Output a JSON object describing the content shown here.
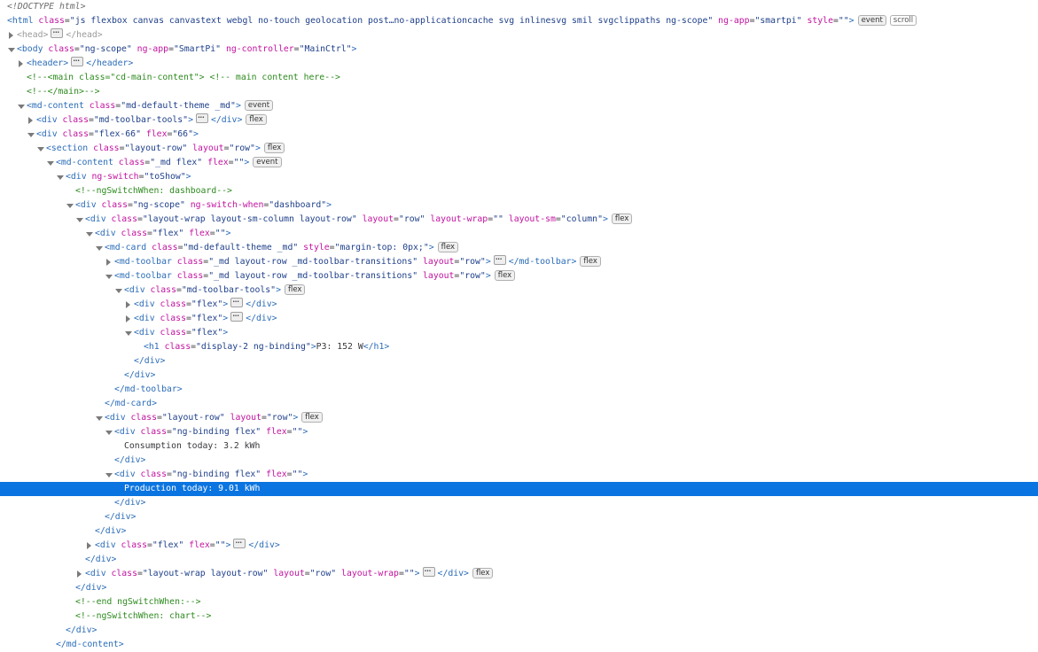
{
  "colors": {
    "selection": "#0a74e0",
    "tag": "#2b6cb8",
    "attr": "#c2129f",
    "value": "#1e3f8a",
    "comment": "#2e8a1f"
  },
  "rows": [
    {
      "depth": -1,
      "twisty": "none",
      "parts": [
        [
          "doctype",
          "<!DOCTYPE html>"
        ]
      ]
    },
    {
      "depth": -1,
      "twisty": "none",
      "parts": [
        [
          "tag",
          "<html"
        ],
        [
          "attr",
          " class"
        ],
        [
          "eq",
          "="
        ],
        [
          "val",
          "\"js flexbox canvas canvastext webgl no-touch geolocation post…no-applicationcache svg inlinesvg smil svgclippaths ng-scope\""
        ],
        [
          "attr",
          " ng-app"
        ],
        [
          "eq",
          "="
        ],
        [
          "val",
          "\"smartpi\""
        ],
        [
          "attr",
          " style"
        ],
        [
          "eq",
          "="
        ],
        [
          "val",
          "\"\""
        ],
        [
          "tag",
          ">"
        ],
        [
          "badge",
          "event"
        ],
        [
          "badge-scroll",
          "scroll"
        ]
      ]
    },
    {
      "depth": 0,
      "twisty": "closed",
      "dim": true,
      "parts": [
        [
          "tag",
          "<head>"
        ],
        [
          "ell",
          "…"
        ],
        [
          "tag",
          "</head>"
        ]
      ]
    },
    {
      "depth": 0,
      "twisty": "open",
      "parts": [
        [
          "tag",
          "<body"
        ],
        [
          "attr",
          " class"
        ],
        [
          "eq",
          "="
        ],
        [
          "val",
          "\"ng-scope\""
        ],
        [
          "attr",
          " ng-app"
        ],
        [
          "eq",
          "="
        ],
        [
          "val",
          "\"SmartPi\""
        ],
        [
          "attr",
          " ng-controller"
        ],
        [
          "eq",
          "="
        ],
        [
          "val",
          "\"MainCtrl\""
        ],
        [
          "tag",
          ">"
        ]
      ]
    },
    {
      "depth": 1,
      "twisty": "closed",
      "parts": [
        [
          "tag",
          "<header>"
        ],
        [
          "ell",
          "…"
        ],
        [
          "tag",
          "</header>"
        ]
      ]
    },
    {
      "depth": 1,
      "twisty": "none",
      "parts": [
        [
          "comment",
          "<!--<main class=\"cd-main-content\"> <!-- main content here-->"
        ]
      ]
    },
    {
      "depth": 1,
      "twisty": "none",
      "parts": [
        [
          "comment",
          "<!--</main>-->"
        ]
      ]
    },
    {
      "depth": 1,
      "twisty": "open",
      "parts": [
        [
          "tag",
          "<md-content"
        ],
        [
          "attr",
          " class"
        ],
        [
          "eq",
          "="
        ],
        [
          "val",
          "\"md-default-theme _md\""
        ],
        [
          "tag",
          ">"
        ],
        [
          "badge",
          "event"
        ]
      ]
    },
    {
      "depth": 2,
      "twisty": "closed",
      "parts": [
        [
          "tag",
          "<div"
        ],
        [
          "attr",
          " class"
        ],
        [
          "eq",
          "="
        ],
        [
          "val",
          "\"md-toolbar-tools\""
        ],
        [
          "tag",
          ">"
        ],
        [
          "ell",
          "…"
        ],
        [
          "tag",
          "</div>"
        ],
        [
          "badge",
          "flex"
        ]
      ]
    },
    {
      "depth": 2,
      "twisty": "open",
      "parts": [
        [
          "tag",
          "<div"
        ],
        [
          "attr",
          " class"
        ],
        [
          "eq",
          "="
        ],
        [
          "val",
          "\"flex-66\""
        ],
        [
          "attr",
          " flex"
        ],
        [
          "eq",
          "="
        ],
        [
          "val",
          "\"66\""
        ],
        [
          "tag",
          ">"
        ]
      ]
    },
    {
      "depth": 3,
      "twisty": "open",
      "parts": [
        [
          "tag",
          "<section"
        ],
        [
          "attr",
          " class"
        ],
        [
          "eq",
          "="
        ],
        [
          "val",
          "\"layout-row\""
        ],
        [
          "attr",
          " layout"
        ],
        [
          "eq",
          "="
        ],
        [
          "val",
          "\"row\""
        ],
        [
          "tag",
          ">"
        ],
        [
          "badge",
          "flex"
        ]
      ]
    },
    {
      "depth": 4,
      "twisty": "open",
      "parts": [
        [
          "tag",
          "<md-content"
        ],
        [
          "attr",
          " class"
        ],
        [
          "eq",
          "="
        ],
        [
          "val",
          "\"_md flex\""
        ],
        [
          "attr",
          " flex"
        ],
        [
          "eq",
          "="
        ],
        [
          "val",
          "\"\""
        ],
        [
          "tag",
          ">"
        ],
        [
          "badge",
          "event"
        ]
      ]
    },
    {
      "depth": 5,
      "twisty": "open",
      "parts": [
        [
          "tag",
          "<div"
        ],
        [
          "attr",
          " ng-switch"
        ],
        [
          "eq",
          "="
        ],
        [
          "val",
          "\"toShow\""
        ],
        [
          "tag",
          ">"
        ]
      ]
    },
    {
      "depth": 6,
      "twisty": "none",
      "parts": [
        [
          "comment",
          "<!--ngSwitchWhen: dashboard-->"
        ]
      ]
    },
    {
      "depth": 6,
      "twisty": "open",
      "parts": [
        [
          "tag",
          "<div"
        ],
        [
          "attr",
          " class"
        ],
        [
          "eq",
          "="
        ],
        [
          "val",
          "\"ng-scope\""
        ],
        [
          "attr",
          " ng-switch-when"
        ],
        [
          "eq",
          "="
        ],
        [
          "val",
          "\"dashboard\""
        ],
        [
          "tag",
          ">"
        ]
      ]
    },
    {
      "depth": 7,
      "twisty": "open",
      "parts": [
        [
          "tag",
          "<div"
        ],
        [
          "attr",
          " class"
        ],
        [
          "eq",
          "="
        ],
        [
          "val",
          "\"layout-wrap layout-sm-column layout-row\""
        ],
        [
          "attr",
          " layout"
        ],
        [
          "eq",
          "="
        ],
        [
          "val",
          "\"row\""
        ],
        [
          "attr",
          " layout-wrap"
        ],
        [
          "eq",
          "="
        ],
        [
          "val",
          "\"\""
        ],
        [
          "attr",
          " layout-sm"
        ],
        [
          "eq",
          "="
        ],
        [
          "val",
          "\"column\""
        ],
        [
          "tag",
          ">"
        ],
        [
          "badge",
          "flex"
        ]
      ]
    },
    {
      "depth": 8,
      "twisty": "open",
      "parts": [
        [
          "tag",
          "<div"
        ],
        [
          "attr",
          " class"
        ],
        [
          "eq",
          "="
        ],
        [
          "val",
          "\"flex\""
        ],
        [
          "attr",
          " flex"
        ],
        [
          "eq",
          "="
        ],
        [
          "val",
          "\"\""
        ],
        [
          "tag",
          ">"
        ]
      ]
    },
    {
      "depth": 9,
      "twisty": "open",
      "parts": [
        [
          "tag",
          "<md-card"
        ],
        [
          "attr",
          " class"
        ],
        [
          "eq",
          "="
        ],
        [
          "val",
          "\"md-default-theme _md\""
        ],
        [
          "attr",
          " style"
        ],
        [
          "eq",
          "="
        ],
        [
          "val",
          "\"margin-top: 0px;\""
        ],
        [
          "tag",
          ">"
        ],
        [
          "badge",
          "flex"
        ]
      ]
    },
    {
      "depth": 10,
      "twisty": "closed",
      "parts": [
        [
          "tag",
          "<md-toolbar"
        ],
        [
          "attr",
          " class"
        ],
        [
          "eq",
          "="
        ],
        [
          "val",
          "\"_md layout-row _md-toolbar-transitions\""
        ],
        [
          "attr",
          " layout"
        ],
        [
          "eq",
          "="
        ],
        [
          "val",
          "\"row\""
        ],
        [
          "tag",
          ">"
        ],
        [
          "ell",
          "…"
        ],
        [
          "tag",
          "</md-toolbar>"
        ],
        [
          "badge",
          "flex"
        ]
      ]
    },
    {
      "depth": 10,
      "twisty": "open",
      "parts": [
        [
          "tag",
          "<md-toolbar"
        ],
        [
          "attr",
          " class"
        ],
        [
          "eq",
          "="
        ],
        [
          "val",
          "\"_md layout-row _md-toolbar-transitions\""
        ],
        [
          "attr",
          " layout"
        ],
        [
          "eq",
          "="
        ],
        [
          "val",
          "\"row\""
        ],
        [
          "tag",
          ">"
        ],
        [
          "badge",
          "flex"
        ]
      ]
    },
    {
      "depth": 11,
      "twisty": "open",
      "parts": [
        [
          "tag",
          "<div"
        ],
        [
          "attr",
          " class"
        ],
        [
          "eq",
          "="
        ],
        [
          "val",
          "\"md-toolbar-tools\""
        ],
        [
          "tag",
          ">"
        ],
        [
          "badge",
          "flex"
        ]
      ]
    },
    {
      "depth": 12,
      "twisty": "closed",
      "parts": [
        [
          "tag",
          "<div"
        ],
        [
          "attr",
          " class"
        ],
        [
          "eq",
          "="
        ],
        [
          "val",
          "\"flex\""
        ],
        [
          "tag",
          ">"
        ],
        [
          "ell",
          "…"
        ],
        [
          "tag",
          "</div>"
        ]
      ]
    },
    {
      "depth": 12,
      "twisty": "closed",
      "parts": [
        [
          "tag",
          "<div"
        ],
        [
          "attr",
          " class"
        ],
        [
          "eq",
          "="
        ],
        [
          "val",
          "\"flex\""
        ],
        [
          "tag",
          ">"
        ],
        [
          "ell",
          "…"
        ],
        [
          "tag",
          "</div>"
        ]
      ]
    },
    {
      "depth": 12,
      "twisty": "open",
      "parts": [
        [
          "tag",
          "<div"
        ],
        [
          "attr",
          " class"
        ],
        [
          "eq",
          "="
        ],
        [
          "val",
          "\"flex\""
        ],
        [
          "tag",
          ">"
        ]
      ]
    },
    {
      "depth": 13,
      "twisty": "none",
      "parts": [
        [
          "tag",
          "<h1"
        ],
        [
          "attr",
          " class"
        ],
        [
          "eq",
          "="
        ],
        [
          "val",
          "\"display-2 ng-binding\""
        ],
        [
          "tag",
          ">"
        ],
        [
          "text",
          "P3: 152 W"
        ],
        [
          "tag",
          "</h1>"
        ]
      ]
    },
    {
      "depth": 12,
      "twisty": "none",
      "parts": [
        [
          "tag",
          "</div>"
        ]
      ]
    },
    {
      "depth": 11,
      "twisty": "none",
      "parts": [
        [
          "tag",
          "</div>"
        ]
      ]
    },
    {
      "depth": 10,
      "twisty": "none",
      "parts": [
        [
          "tag",
          "</md-toolbar>"
        ]
      ]
    },
    {
      "depth": 9,
      "twisty": "none",
      "parts": [
        [
          "tag",
          "</md-card>"
        ]
      ]
    },
    {
      "depth": 9,
      "twisty": "open",
      "parts": [
        [
          "tag",
          "<div"
        ],
        [
          "attr",
          " class"
        ],
        [
          "eq",
          "="
        ],
        [
          "val",
          "\"layout-row\""
        ],
        [
          "attr",
          " layout"
        ],
        [
          "eq",
          "="
        ],
        [
          "val",
          "\"row\""
        ],
        [
          "tag",
          ">"
        ],
        [
          "badge",
          "flex"
        ]
      ]
    },
    {
      "depth": 10,
      "twisty": "open",
      "parts": [
        [
          "tag",
          "<div"
        ],
        [
          "attr",
          " class"
        ],
        [
          "eq",
          "="
        ],
        [
          "val",
          "\"ng-binding flex\""
        ],
        [
          "attr",
          " flex"
        ],
        [
          "eq",
          "="
        ],
        [
          "val",
          "\"\""
        ],
        [
          "tag",
          ">"
        ]
      ]
    },
    {
      "depth": 11,
      "twisty": "none",
      "parts": [
        [
          "text",
          "Consumption today: 3.2 kWh"
        ]
      ]
    },
    {
      "depth": 10,
      "twisty": "none",
      "parts": [
        [
          "tag",
          "</div>"
        ]
      ]
    },
    {
      "depth": 10,
      "twisty": "open",
      "parts": [
        [
          "tag",
          "<div"
        ],
        [
          "attr",
          " class"
        ],
        [
          "eq",
          "="
        ],
        [
          "val",
          "\"ng-binding flex\""
        ],
        [
          "attr",
          " flex"
        ],
        [
          "eq",
          "="
        ],
        [
          "val",
          "\"\""
        ],
        [
          "tag",
          ">"
        ]
      ]
    },
    {
      "depth": 11,
      "twisty": "none",
      "selected": true,
      "parts": [
        [
          "text",
          "Production today: 9.01 kWh"
        ]
      ]
    },
    {
      "depth": 10,
      "twisty": "none",
      "parts": [
        [
          "tag",
          "</div>"
        ]
      ]
    },
    {
      "depth": 9,
      "twisty": "none",
      "parts": [
        [
          "tag",
          "</div>"
        ]
      ]
    },
    {
      "depth": 8,
      "twisty": "none",
      "parts": [
        [
          "tag",
          "</div>"
        ]
      ]
    },
    {
      "depth": 8,
      "twisty": "closed",
      "parts": [
        [
          "tag",
          "<div"
        ],
        [
          "attr",
          " class"
        ],
        [
          "eq",
          "="
        ],
        [
          "val",
          "\"flex\""
        ],
        [
          "attr",
          " flex"
        ],
        [
          "eq",
          "="
        ],
        [
          "val",
          "\"\""
        ],
        [
          "tag",
          ">"
        ],
        [
          "ell",
          "…"
        ],
        [
          "tag",
          "</div>"
        ]
      ]
    },
    {
      "depth": 7,
      "twisty": "none",
      "parts": [
        [
          "tag",
          "</div>"
        ]
      ]
    },
    {
      "depth": 7,
      "twisty": "closed",
      "parts": [
        [
          "tag",
          "<div"
        ],
        [
          "attr",
          " class"
        ],
        [
          "eq",
          "="
        ],
        [
          "val",
          "\"layout-wrap layout-row\""
        ],
        [
          "attr",
          " layout"
        ],
        [
          "eq",
          "="
        ],
        [
          "val",
          "\"row\""
        ],
        [
          "attr",
          " layout-wrap"
        ],
        [
          "eq",
          "="
        ],
        [
          "val",
          "\"\""
        ],
        [
          "tag",
          ">"
        ],
        [
          "ell",
          "…"
        ],
        [
          "tag",
          "</div>"
        ],
        [
          "badge",
          "flex"
        ]
      ]
    },
    {
      "depth": 6,
      "twisty": "none",
      "parts": [
        [
          "tag",
          "</div>"
        ]
      ]
    },
    {
      "depth": 6,
      "twisty": "none",
      "parts": [
        [
          "comment",
          "<!--end ngSwitchWhen:-->"
        ]
      ]
    },
    {
      "depth": 6,
      "twisty": "none",
      "parts": [
        [
          "comment",
          "<!--ngSwitchWhen: chart-->"
        ]
      ]
    },
    {
      "depth": 5,
      "twisty": "none",
      "parts": [
        [
          "tag",
          "</div>"
        ]
      ]
    },
    {
      "depth": 4,
      "twisty": "none",
      "parts": [
        [
          "tag",
          "</md-content>"
        ]
      ]
    }
  ]
}
